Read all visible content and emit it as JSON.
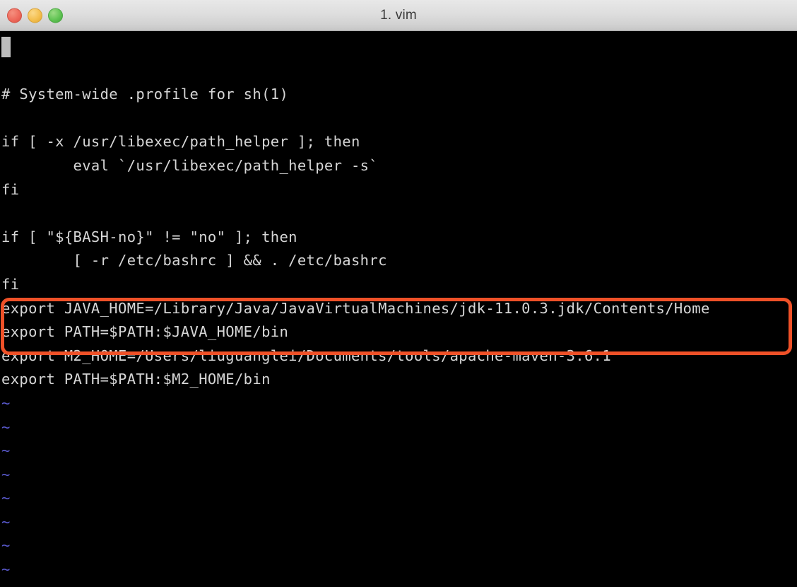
{
  "window": {
    "title": "1. vim",
    "traffic_lights": [
      {
        "name": "close",
        "color": "#ee6a5c"
      },
      {
        "name": "minimize",
        "color": "#f4bf4f"
      },
      {
        "name": "zoom",
        "color": "#61c454"
      }
    ]
  },
  "terminal": {
    "background_color": "#000000",
    "foreground_color": "#d6d6d6",
    "tilde_color": "#5a5acf",
    "cursor_color": "#bdbdbd",
    "lines": [
      {
        "type": "cursor",
        "text": ""
      },
      {
        "type": "blank",
        "text": ""
      },
      {
        "type": "text",
        "text": "# System-wide .profile for sh(1)"
      },
      {
        "type": "blank",
        "text": ""
      },
      {
        "type": "text",
        "text": "if [ -x /usr/libexec/path_helper ]; then"
      },
      {
        "type": "text",
        "text": "        eval `/usr/libexec/path_helper -s`"
      },
      {
        "type": "text",
        "text": "fi"
      },
      {
        "type": "blank",
        "text": ""
      },
      {
        "type": "text",
        "text": "if [ \"${BASH-no}\" != \"no\" ]; then"
      },
      {
        "type": "text",
        "text": "        [ -r /etc/bashrc ] && . /etc/bashrc"
      },
      {
        "type": "text",
        "text": "fi"
      },
      {
        "type": "text",
        "text": "export JAVA_HOME=/Library/Java/JavaVirtualMachines/jdk-11.0.3.jdk/Contents/Home"
      },
      {
        "type": "text",
        "text": "export PATH=$PATH:$JAVA_HOME/bin"
      },
      {
        "type": "text",
        "text": "export M2_HOME=/Users/liuguanglei/Documents/tools/apache-maven-3.6.1"
      },
      {
        "type": "text",
        "text": "export PATH=$PATH:$M2_HOME/bin"
      },
      {
        "type": "tilde",
        "text": "~"
      },
      {
        "type": "tilde",
        "text": "~"
      },
      {
        "type": "tilde",
        "text": "~"
      },
      {
        "type": "tilde",
        "text": "~"
      },
      {
        "type": "tilde",
        "text": "~"
      },
      {
        "type": "tilde",
        "text": "~"
      },
      {
        "type": "tilde",
        "text": "~"
      },
      {
        "type": "tilde",
        "text": "~"
      }
    ]
  },
  "annotation": {
    "type": "rectangle-highlight",
    "color": "#ef5128",
    "covers_lines": [
      "export JAVA_HOME=/Library/Java/JavaVirtualMachines/jdk-11.0.3.jdk/Contents/Home",
      "export PATH=$PATH:$JAVA_HOME/bin"
    ]
  }
}
